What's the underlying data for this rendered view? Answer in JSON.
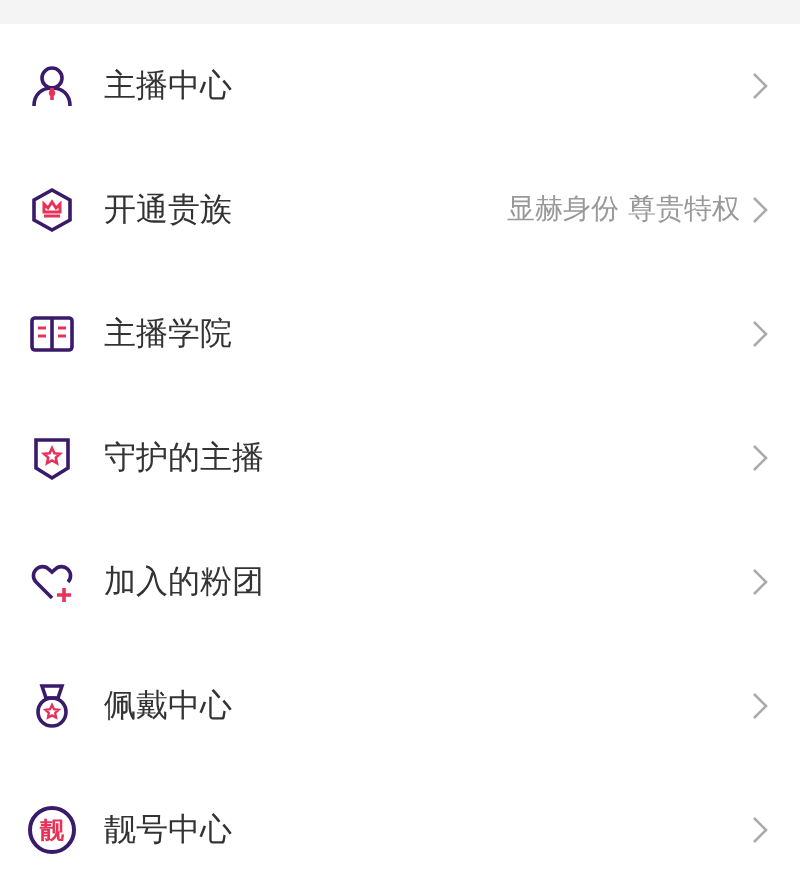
{
  "menu": [
    {
      "kind": "person",
      "label": "主播中心"
    },
    {
      "kind": "crown",
      "label": "开通贵族",
      "hint": "显赫身份 尊贵特权"
    },
    {
      "kind": "book",
      "label": "主播学院"
    },
    {
      "kind": "shield",
      "label": "守护的主播"
    },
    {
      "kind": "heart",
      "label": "加入的粉团"
    },
    {
      "kind": "medal",
      "label": "佩戴中心"
    },
    {
      "kind": "badge",
      "label": "靓号中心",
      "icon_text": "靓"
    }
  ]
}
